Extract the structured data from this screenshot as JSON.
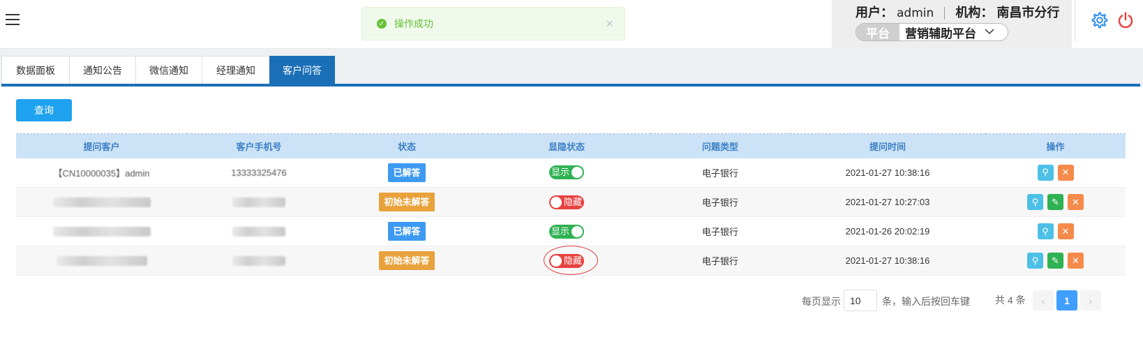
{
  "toast": {
    "message": "操作成功",
    "close": "×"
  },
  "user": {
    "user_label": "用户：",
    "user_value": "admin",
    "org_label": "机构：",
    "org_value": "南昌市分行"
  },
  "platform": {
    "label": "平台",
    "value": "营销辅助平台"
  },
  "tabs": [
    {
      "label": "数据面板",
      "active": false
    },
    {
      "label": "通知公告",
      "active": false
    },
    {
      "label": "微信通知",
      "active": false
    },
    {
      "label": "经理通知",
      "active": false
    },
    {
      "label": "客户问答",
      "active": true
    }
  ],
  "toolbar": {
    "query_label": "查询"
  },
  "table": {
    "headers": [
      "提问客户",
      "客户手机号",
      "状态",
      "显隐状态",
      "问题类型",
      "提问时间",
      "操作"
    ],
    "rows": [
      {
        "customer": "【CN10000035】admin",
        "phone": "13333325476",
        "status": "已解答",
        "status_type": "answered",
        "visibility": "显示",
        "visible": true,
        "qtype": "电子银行",
        "time": "2021-01-27 10:38:16",
        "actions": [
          "view",
          "delete"
        ]
      },
      {
        "customer": "",
        "phone": "",
        "status": "初始未解答",
        "status_type": "pending",
        "visibility": "隐藏",
        "visible": false,
        "qtype": "电子银行",
        "time": "2021-01-27 10:27:03",
        "actions": [
          "view",
          "edit",
          "delete"
        ]
      },
      {
        "customer": "",
        "phone": "",
        "status": "已解答",
        "status_type": "answered",
        "visibility": "显示",
        "visible": true,
        "qtype": "电子银行",
        "time": "2021-01-26 20:02:19",
        "actions": [
          "view",
          "delete"
        ]
      },
      {
        "customer": "",
        "phone": "",
        "status": "初始未解答",
        "status_type": "pending",
        "visibility": "隐藏",
        "visible": false,
        "qtype": "电子银行",
        "time": "2021-01-27 10:38:16",
        "actions": [
          "view",
          "edit",
          "delete"
        ]
      }
    ]
  },
  "pagination": {
    "per_page_label": "每页显示",
    "page_size": "10",
    "hint": "条，输入后按回车键",
    "total": "共 4 条",
    "current_page": "1",
    "prev": "‹",
    "next": "›"
  },
  "colors": {
    "primary": "#1b6fb6",
    "query": "#1fa2ef",
    "answered": "#3d9af2",
    "pending": "#e9a23b",
    "on": "#2fb253",
    "off": "#e8423f",
    "success": "#67c23a"
  }
}
